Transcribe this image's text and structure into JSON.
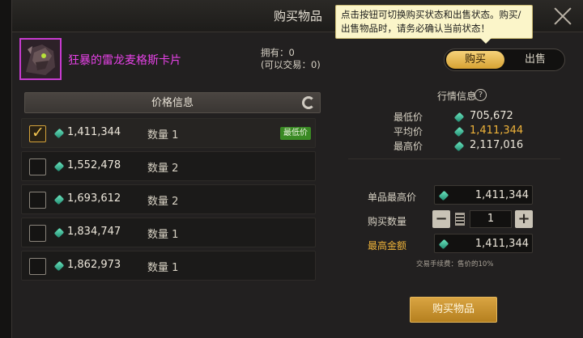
{
  "window": {
    "title": "购买物品"
  },
  "tooltip": {
    "text": "点击按钮可切换购买状态和出售状态。购买/出售物品时，请务必确认当前状态！"
  },
  "item": {
    "name": "狂暴的雷龙麦格斯卡片",
    "owned": "拥有：0",
    "tradable": "(可以交易：0)"
  },
  "mode_toggle": {
    "buy": "购买",
    "sell": "出售",
    "selected": "购买"
  },
  "price_panel": {
    "title": "价格信息",
    "rows": [
      {
        "price": "1,411,344",
        "qty": "数量 1",
        "badge": "最低价",
        "checked": true
      },
      {
        "price": "1,552,478",
        "qty": "数量 2",
        "badge": "",
        "checked": false
      },
      {
        "price": "1,693,612",
        "qty": "数量 2",
        "badge": "",
        "checked": false
      },
      {
        "price": "1,834,747",
        "qty": "数量 1",
        "badge": "",
        "checked": false
      },
      {
        "price": "1,862,973",
        "qty": "数量 1",
        "badge": "",
        "checked": false
      }
    ]
  },
  "market": {
    "title": "行情信息",
    "help": "?",
    "lowest_label": "最低价",
    "lowest": "705,672",
    "average_label": "平均价",
    "average": "1,411,344",
    "highest_label": "最高价",
    "highest": "2,117,016"
  },
  "form": {
    "unit_max_label": "单品最高价",
    "unit_max": "1,411,344",
    "quantity_label": "购买数量",
    "quantity": "1",
    "total_label": "最高金额",
    "total": "1,411,344",
    "fee_note": "交易手续费：售价的10%"
  },
  "buy_button": "购买物品",
  "colors": {
    "accent_gold": "#f0b43a",
    "item_purple": "#e642e6",
    "badge_green": "#3a8a24"
  }
}
